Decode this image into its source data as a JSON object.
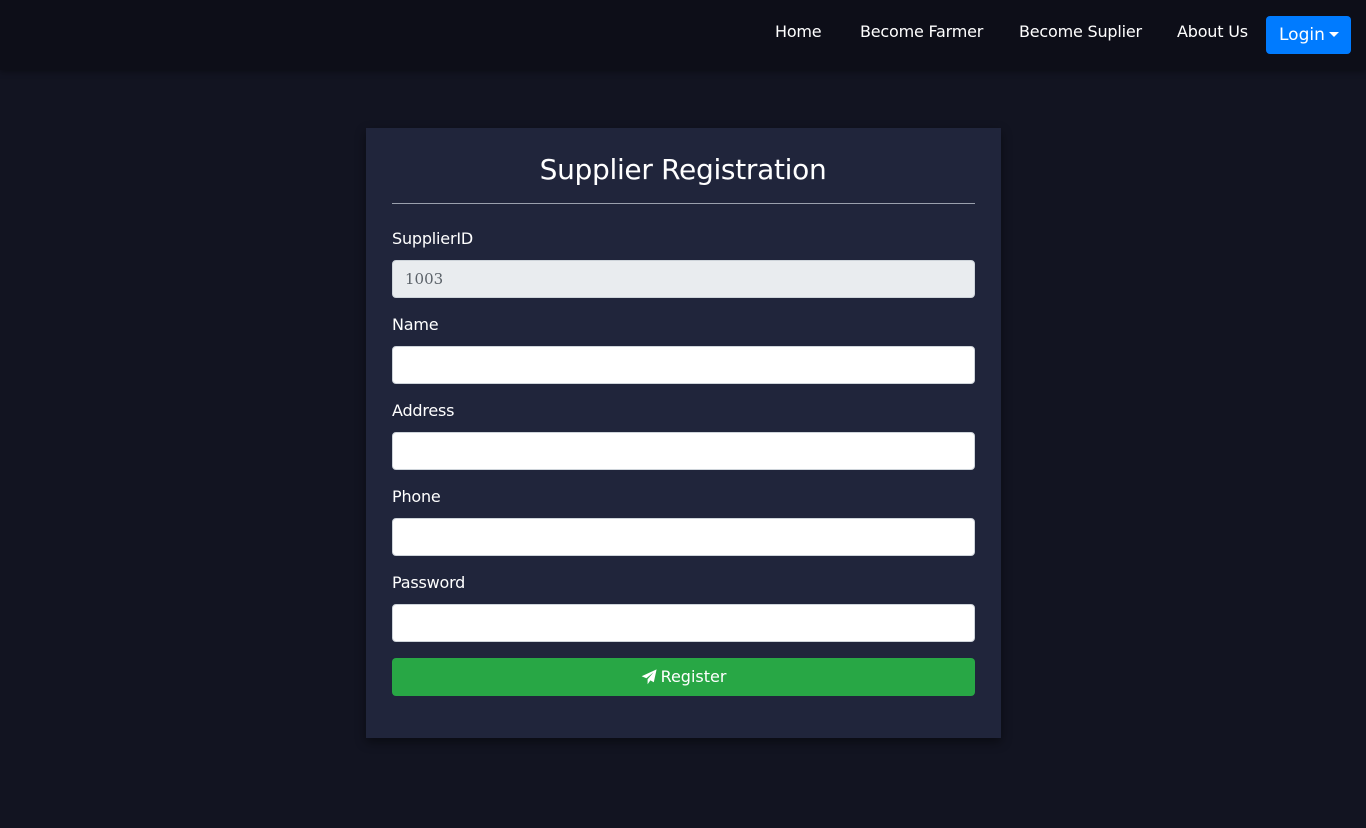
{
  "nav": {
    "items": [
      {
        "label": "Home"
      },
      {
        "label": "Become Farmer"
      },
      {
        "label": "Become Suplier"
      },
      {
        "label": "About Us"
      }
    ],
    "login_label": "Login",
    "login_icon": "caret-down-icon",
    "login_color": "#007bff"
  },
  "form": {
    "title": "Supplier Registration",
    "fields": [
      {
        "label": "SupplierID",
        "value": "1003",
        "readonly": true
      },
      {
        "label": "Name",
        "value": ""
      },
      {
        "label": "Address",
        "value": ""
      },
      {
        "label": "Phone",
        "value": ""
      },
      {
        "label": "Password",
        "value": ""
      }
    ],
    "submit_label": "Register",
    "submit_icon": "paper-plane-icon",
    "submit_color": "#28a745"
  }
}
